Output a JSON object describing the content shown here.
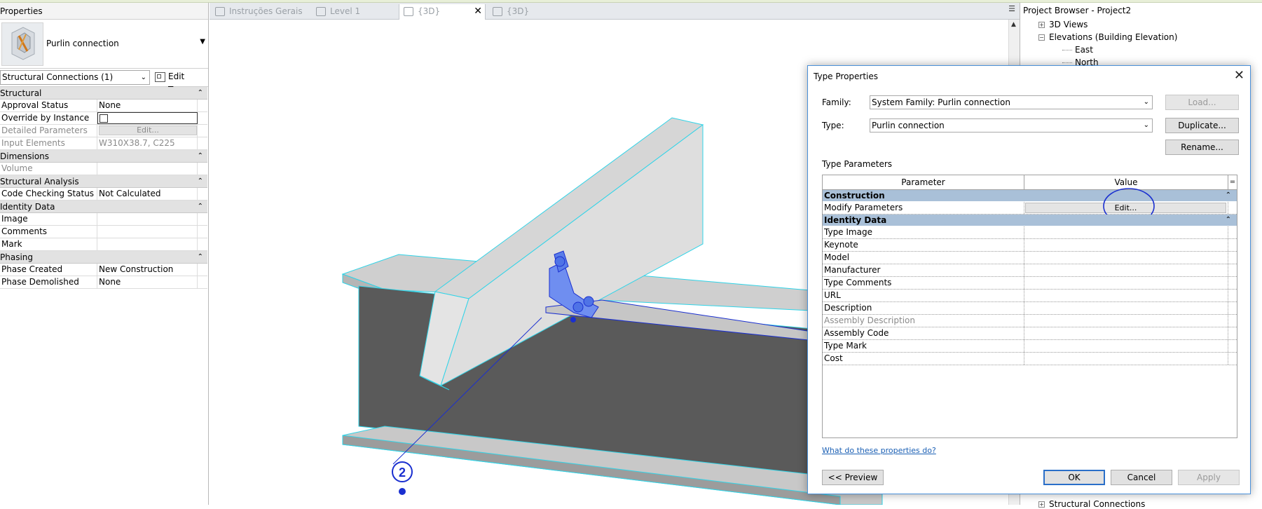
{
  "properties": {
    "title": "Properties",
    "type_name": "Purlin connection",
    "filter": "Structural Connections (1)",
    "edit_type": "Edit Type",
    "groups": [
      {
        "name": "Structural",
        "rows": [
          {
            "key": "Approval Status",
            "value": "None"
          },
          {
            "key": "Override by Instance",
            "value": ""
          },
          {
            "key": "Detailed Parameters",
            "value": "Edit..."
          },
          {
            "key": "Input Elements",
            "value": "W310X38.7, C225"
          }
        ]
      },
      {
        "name": "Dimensions",
        "rows": [
          {
            "key": "Volume",
            "value": ""
          }
        ]
      },
      {
        "name": "Structural Analysis",
        "rows": [
          {
            "key": "Code Checking Status",
            "value": "Not Calculated"
          }
        ]
      },
      {
        "name": "Identity Data",
        "rows": [
          {
            "key": "Image",
            "value": ""
          },
          {
            "key": "Comments",
            "value": ""
          },
          {
            "key": "Mark",
            "value": ""
          }
        ]
      },
      {
        "name": "Phasing",
        "rows": [
          {
            "key": "Phase Created",
            "value": "New Construction"
          },
          {
            "key": "Phase Demolished",
            "value": "None"
          }
        ]
      }
    ]
  },
  "tabs": [
    {
      "label": "Instruções Gerais"
    },
    {
      "label": "Level 1"
    },
    {
      "label": "{3D}",
      "active": true
    },
    {
      "label": "{3D}"
    }
  ],
  "viewport": {
    "marker_label": "2"
  },
  "browser": {
    "title": "Project Browser - Project2",
    "nodes": [
      {
        "label": "3D Views",
        "expander": "+"
      },
      {
        "label": "Elevations (Building Elevation)",
        "expander": "−"
      },
      {
        "label": "East"
      },
      {
        "label": "North"
      },
      {
        "label": "Structural Connections",
        "expander": "+"
      }
    ]
  },
  "dialog": {
    "title": "Type Properties",
    "family_label": "Family:",
    "family_value": "System Family: Purlin connection",
    "type_label": "Type:",
    "type_value": "Purlin connection",
    "load_button": "Load...",
    "duplicate_button": "Duplicate...",
    "rename_button": "Rename...",
    "type_parameters_label": "Type Parameters",
    "col_parameter": "Parameter",
    "col_value": "Value",
    "col_eq": "=",
    "construction_group": "Construction",
    "modify_parameters": "Modify Parameters",
    "edit_button": "Edit...",
    "identity_group": "Identity Data",
    "identity_rows": [
      {
        "key": "Type Image"
      },
      {
        "key": "Keynote"
      },
      {
        "key": "Model"
      },
      {
        "key": "Manufacturer"
      },
      {
        "key": "Type Comments"
      },
      {
        "key": "URL"
      },
      {
        "key": "Description"
      },
      {
        "key": "Assembly Description",
        "dim": true
      },
      {
        "key": "Assembly Code"
      },
      {
        "key": "Type Mark"
      },
      {
        "key": "Cost"
      }
    ],
    "help_link": "What do these properties do?",
    "preview_button": "<< Preview",
    "ok_button": "OK",
    "cancel_button": "Cancel",
    "apply_button": "Apply"
  },
  "colors": {
    "accent": "#2a6fc9",
    "group_header": "#a9c0d8",
    "selection_cyan": "#2fd4e8",
    "annotation_blue": "#1a2fd0"
  }
}
